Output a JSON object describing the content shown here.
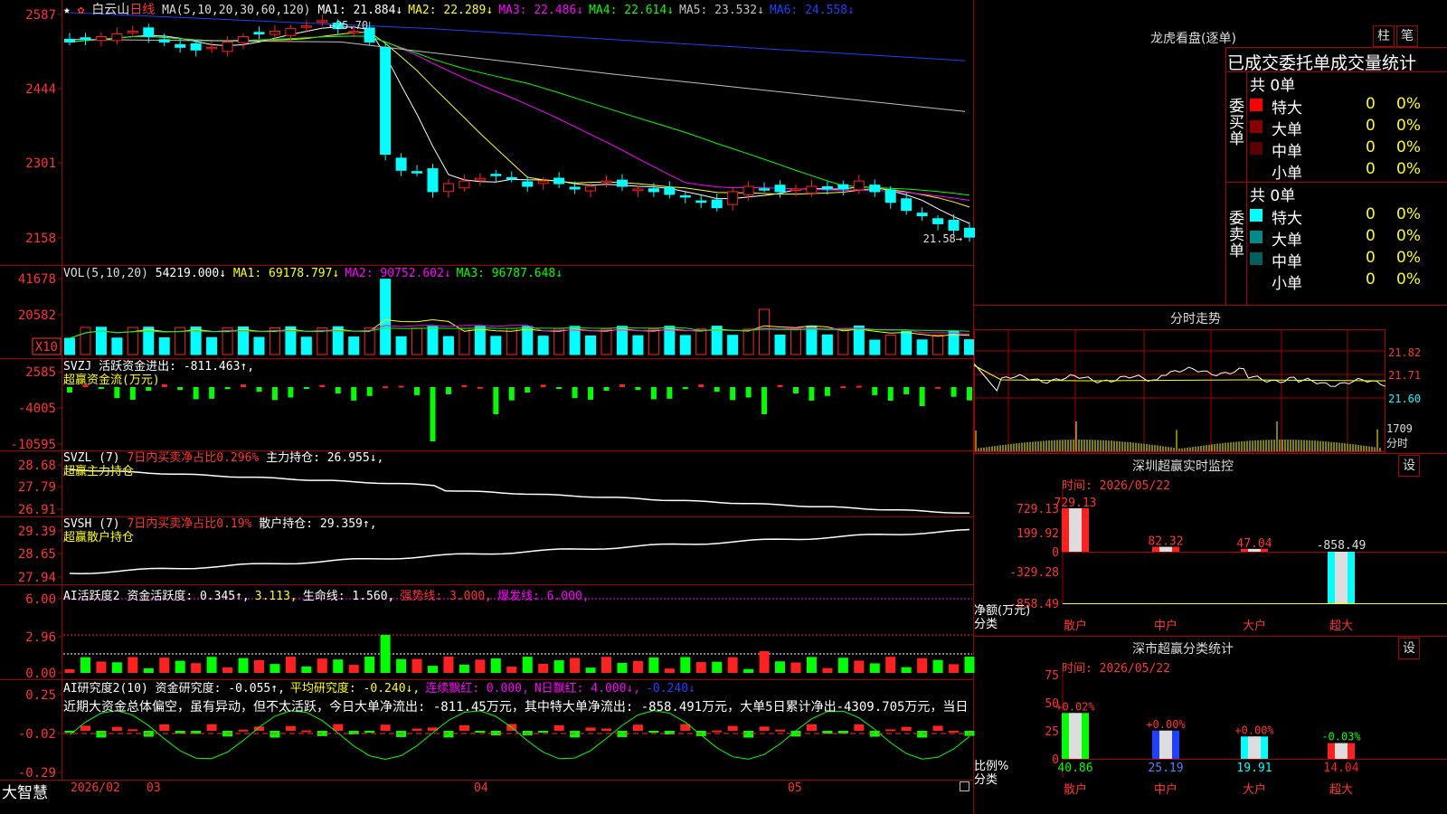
{
  "stock": {
    "name": "白云山",
    "period": "日线",
    "star": "★"
  },
  "main_legend": {
    "ma_def": "MA(5,10,20,30,60,120)",
    "items": [
      {
        "label": "MA1: 21.884↓",
        "color": "#ffffff"
      },
      {
        "label": "MA2: 22.289↓",
        "color": "#ffff00"
      },
      {
        "label": "MA3: 22.486↓",
        "color": "#ff00ff"
      },
      {
        "label": "MA4: 22.614↓",
        "color": "#00ff00"
      },
      {
        "label": "MA5: 23.532↓",
        "color": "#c0c0c0"
      },
      {
        "label": "MA6: 24.558↓",
        "color": "#1e40ff"
      }
    ]
  },
  "vol_legend": {
    "def": "VOL(5,10,20)",
    "value": "54219.000↓",
    "items": [
      {
        "label": "MA1: 69178.797↓",
        "color": "#ffff00"
      },
      {
        "label": "MA2: 90752.602↓",
        "color": "#ff00ff"
      },
      {
        "label": "MA3: 96787.648↓",
        "color": "#00ff00"
      }
    ]
  },
  "svzj_legend": {
    "text": "SVZJ  活跃资金进出: -811.463↑,",
    "sub": "超赢资金流(万元)"
  },
  "svzl_legend": {
    "name": "SVZL (7)",
    "ratio": "7日内买卖净占比0.296%",
    "value": "主力持仓: 26.955↓,",
    "sub": "超赢主力持仓"
  },
  "svsh_legend": {
    "name": "SVSH (7)",
    "ratio": "7日内买卖净占比0.19%",
    "value": "散户持仓: 29.359↑,",
    "sub": "超赢散户持仓"
  },
  "ai_legend": {
    "name": "AI活跃度2",
    "items": [
      {
        "label": "资金活跃度: 0.345↑,",
        "color": "#ffffff"
      },
      {
        "label": "3.113,",
        "color": "#ffff00"
      },
      {
        "label": "生命线: 1.560,",
        "color": "#ffffff"
      },
      {
        "label": "强势线: 3.000,",
        "color": "#ff3030"
      },
      {
        "label": "爆发线: 6.000,",
        "color": "#ff00ff"
      }
    ]
  },
  "research_legend": {
    "name": "AI研究度2(10)",
    "items": [
      {
        "label": "资金研究度: -0.055↑,",
        "color": "#ffffff"
      },
      {
        "label": "平均研究度: -0.240↓,",
        "color": "#ffff00"
      },
      {
        "label": "连续飘红: 0.000,",
        "color": "#ff00ff"
      },
      {
        "label": "N日飘红: 4.000↓,",
        "color": "#ff00ff"
      },
      {
        "label": "-0.240↓",
        "color": "#1e40ff"
      }
    ],
    "summary": "近期大资金总体偏空，虽有异动，但不太活跃，今日大单净流出: -811.45万元，其中特大单净流出: -858.491万元，大单5日累计净出-4309.705万元，当日"
  },
  "y_axes": {
    "main": [
      "2587",
      "2444",
      "2301",
      "2158"
    ],
    "vol": [
      "41678",
      "20582"
    ],
    "vol_unit": "X10",
    "svzj": [
      "2585",
      "-4005",
      "-10595"
    ],
    "svzl": [
      "28.68",
      "27.79",
      "26.91"
    ],
    "svsh": [
      "29.39",
      "28.65",
      "27.94"
    ],
    "ai": [
      "6.00",
      "2.96",
      "0.00"
    ],
    "research": [
      "0.25",
      "-0.02",
      "-0.29"
    ]
  },
  "x_axis": {
    "year_month": "2026/02",
    "months": [
      "03",
      "04",
      "05"
    ]
  },
  "price_annotations": {
    "high": "←25.70",
    "low": "21.58→"
  },
  "brand": "大智慧",
  "right": {
    "dragon_title": "龙虎看盘(逐单)",
    "btn_column": "柱",
    "btn_stroke": "笔",
    "order_header": "已成交委托单成交量统计",
    "buy_total": "共 0单",
    "sell_total": "共 0单",
    "buy_side": [
      "委",
      "买",
      "单"
    ],
    "sell_side": [
      "委",
      "卖",
      "单"
    ],
    "buy_rows": [
      {
        "label": "特大",
        "count": "0",
        "pct": "0%",
        "color": "#ff0000"
      },
      {
        "label": "大单",
        "count": "0",
        "pct": "0%",
        "color": "#8b0000"
      },
      {
        "label": "中单",
        "count": "0",
        "pct": "0%",
        "color": "#5a0000"
      },
      {
        "label": "小单",
        "count": "0",
        "pct": "0%",
        "color": ""
      }
    ],
    "sell_rows": [
      {
        "label": "特大",
        "count": "0",
        "pct": "0%",
        "color": "#00ffff"
      },
      {
        "label": "大单",
        "count": "0",
        "pct": "0%",
        "color": "#008b8b"
      },
      {
        "label": "中单",
        "count": "0",
        "pct": "0%",
        "color": "#006060"
      },
      {
        "label": "小单",
        "count": "0",
        "pct": "0%",
        "color": ""
      }
    ],
    "intraday_title": "分时走势",
    "intraday_prices": [
      "21.82",
      "21.71",
      "21.60"
    ],
    "intraday_vol": "1709",
    "intraday_vol_unit": "分时",
    "monitor_title": "深圳超赢实时监控",
    "monitor_btn": "设",
    "monitor_time": "时间: 2026/05/22",
    "monitor_yticks": [
      "729.13",
      "199.92",
      "0",
      "-329.28",
      "-858.49"
    ],
    "monitor_ylabel": "净额(万元)",
    "monitor_xlabel": "分类",
    "stat_title": "深市超赢分类统计",
    "stat_btn": "设",
    "stat_time": "时间: 2026/05/22",
    "stat_yticks": [
      "75",
      "50",
      "25",
      "0"
    ],
    "stat_ylabel": "比例%",
    "stat_xlabel": "分类"
  },
  "chart_data": [
    {
      "type": "bar",
      "title": "深圳超赢实时监控",
      "ylabel": "净额(万元)",
      "categories": [
        "散户",
        "中户",
        "大户",
        "超大"
      ],
      "values": [
        729.13,
        82.32,
        47.04,
        -858.49
      ],
      "labels": [
        "729.13",
        "82.32",
        "47.04",
        "-858.49"
      ],
      "ylim": [
        -858.49,
        729.13
      ]
    },
    {
      "type": "bar",
      "title": "深市超赢分类统计",
      "ylabel": "比例%",
      "categories": [
        "散户",
        "中户",
        "大户",
        "超大"
      ],
      "values": [
        40.86,
        25.19,
        19.91,
        14.04
      ],
      "changes": [
        "+0.02%",
        "+0.00%",
        "+0.00%",
        "-0.03%"
      ],
      "colors": [
        "#00ff00",
        "#1e40ff",
        "#00ffff",
        "#ff2020"
      ],
      "ylim": [
        0,
        75
      ]
    },
    {
      "type": "line",
      "title": "白云山日线",
      "note": "candlestick main chart, approximate daily closes",
      "values": [
        25.3,
        25.35,
        25.4,
        25.45,
        25.5,
        25.4,
        25.3,
        25.2,
        25.15,
        25.2,
        25.3,
        25.4,
        25.45,
        25.5,
        25.55,
        25.6,
        25.7,
        25.55,
        25.5,
        25.3,
        23.2,
        22.9,
        22.85,
        22.5,
        22.65,
        22.7,
        22.75,
        22.8,
        22.75,
        22.6,
        22.7,
        22.65,
        22.55,
        22.6,
        22.7,
        22.6,
        22.55,
        22.5,
        22.45,
        22.4,
        22.3,
        22.2,
        22.5,
        22.6,
        22.55,
        22.5,
        22.55,
        22.6,
        22.55,
        22.55,
        22.7,
        22.5,
        22.3,
        22.15,
        22.05,
        21.9,
        21.78,
        21.65
      ]
    }
  ]
}
